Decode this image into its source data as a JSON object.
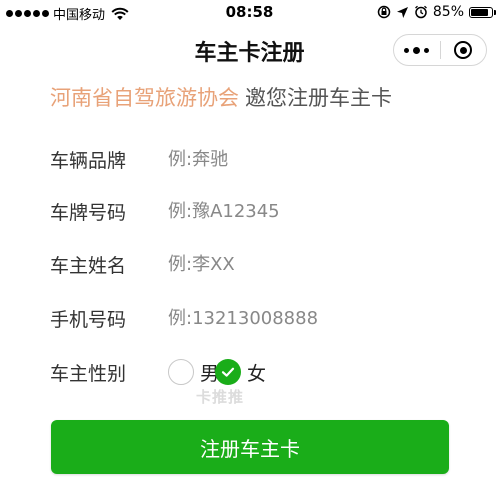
{
  "status_bar": {
    "carrier": "中国移动",
    "time": "08:58",
    "battery_percent": "85%",
    "battery_level": 0.85,
    "icons": [
      "signal-dots-icon",
      "wifi-icon",
      "rotation-lock-icon",
      "location-arrow-icon",
      "alarm-icon",
      "battery-icon"
    ]
  },
  "nav": {
    "title": "车主卡注册",
    "icons": [
      "more-dots-icon",
      "close-target-icon"
    ]
  },
  "headline": {
    "organization": "河南省自驾旅游协会",
    "invitation": "邀您注册车主卡",
    "organization_color": "#e8a278"
  },
  "form": {
    "fields": [
      {
        "label": "车辆品牌",
        "placeholder": "例:奔驰",
        "value": ""
      },
      {
        "label": "车牌号码",
        "placeholder": "例:豫A12345",
        "value": ""
      },
      {
        "label": "车主姓名",
        "placeholder": "例:李XX",
        "value": ""
      },
      {
        "label": "手机号码",
        "placeholder": "例:13213008888",
        "value": ""
      }
    ],
    "gender": {
      "label": "车主性别",
      "options": [
        {
          "label": "男",
          "checked": false
        },
        {
          "label": "女",
          "checked": true
        }
      ]
    },
    "submit_label": "注册车主卡",
    "accent_color": "#1aad19"
  },
  "watermark": "卡推推"
}
